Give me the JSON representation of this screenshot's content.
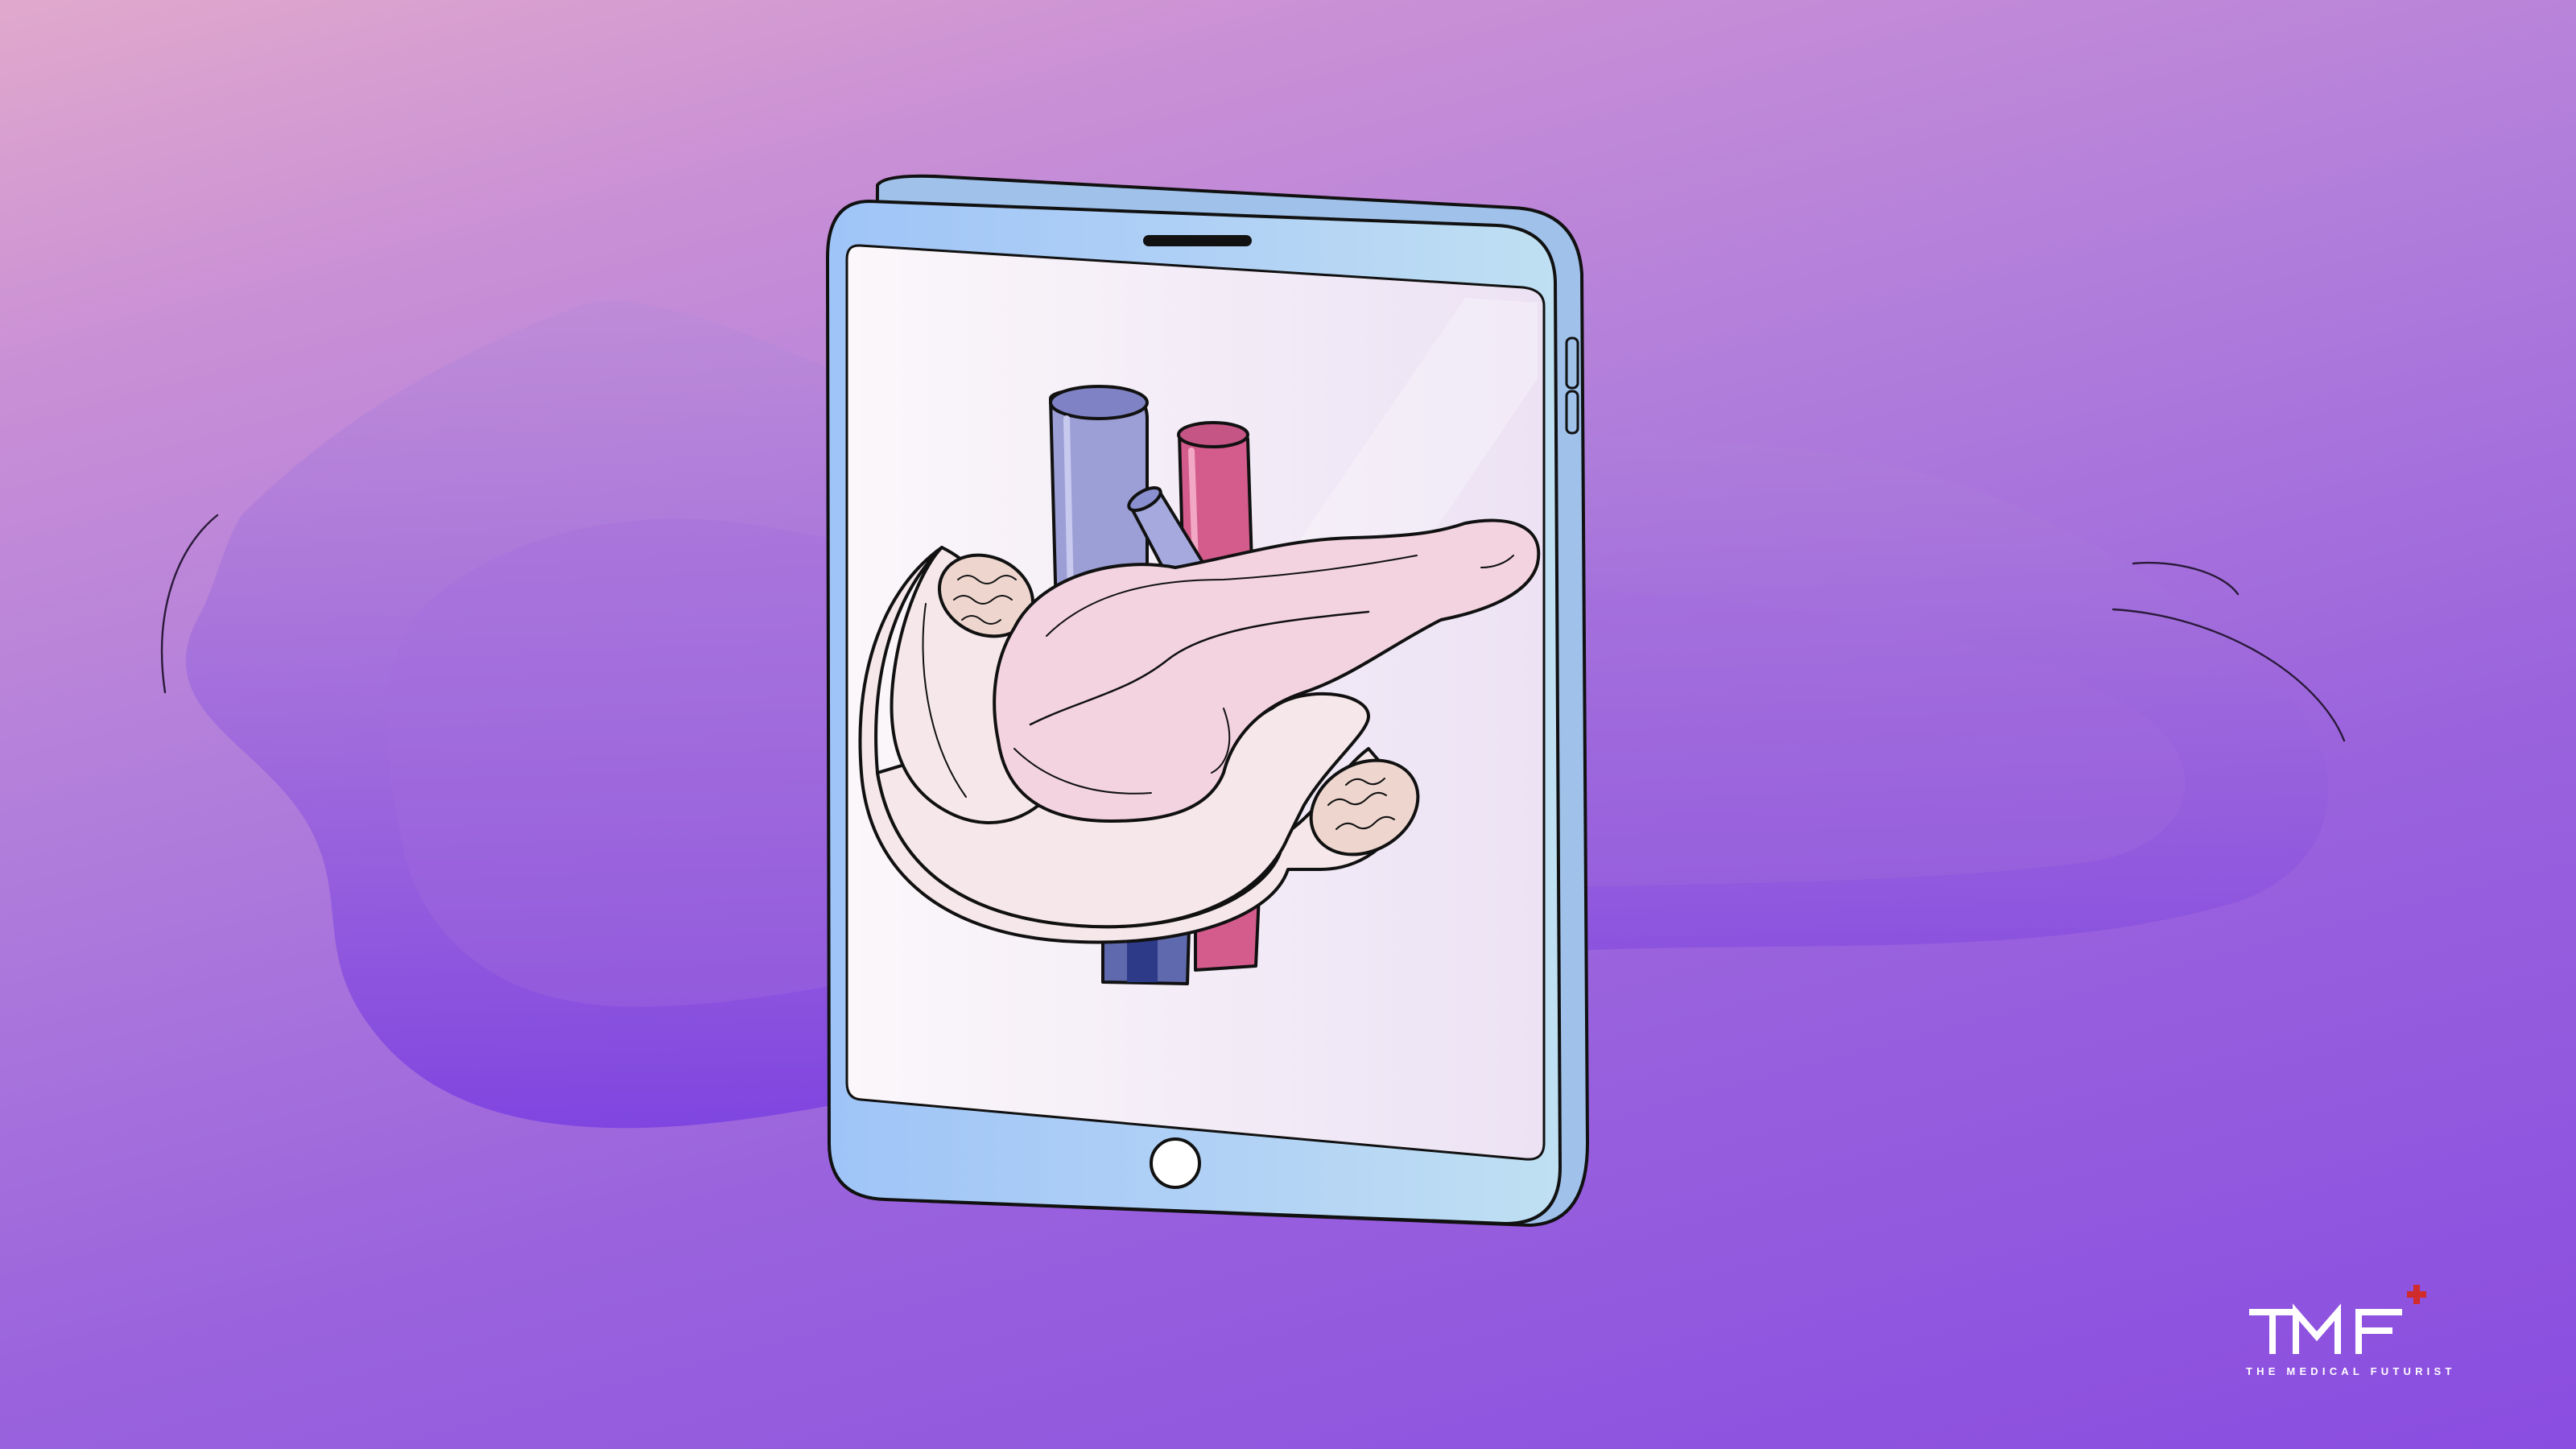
{
  "illustration": {
    "subject": "tablet showing anatomical illustration of pancreas with duodenum and blood vessels",
    "colors": {
      "background_top": "#e0a9cc",
      "background_bottom": "#8a4de0",
      "blob": "#9b5ad9",
      "tablet_frame": "#a8cbf5",
      "screen": "#f4eef8",
      "pancreas": "#f3d3e0",
      "duodenum": "#f6e7ea",
      "vein": "#8a8fd0",
      "artery": "#d45c8c",
      "logo_plus": "#d12b2b"
    }
  },
  "logo": {
    "mark": "TMF",
    "tagline": "THE MEDICAL FUTURIST"
  }
}
